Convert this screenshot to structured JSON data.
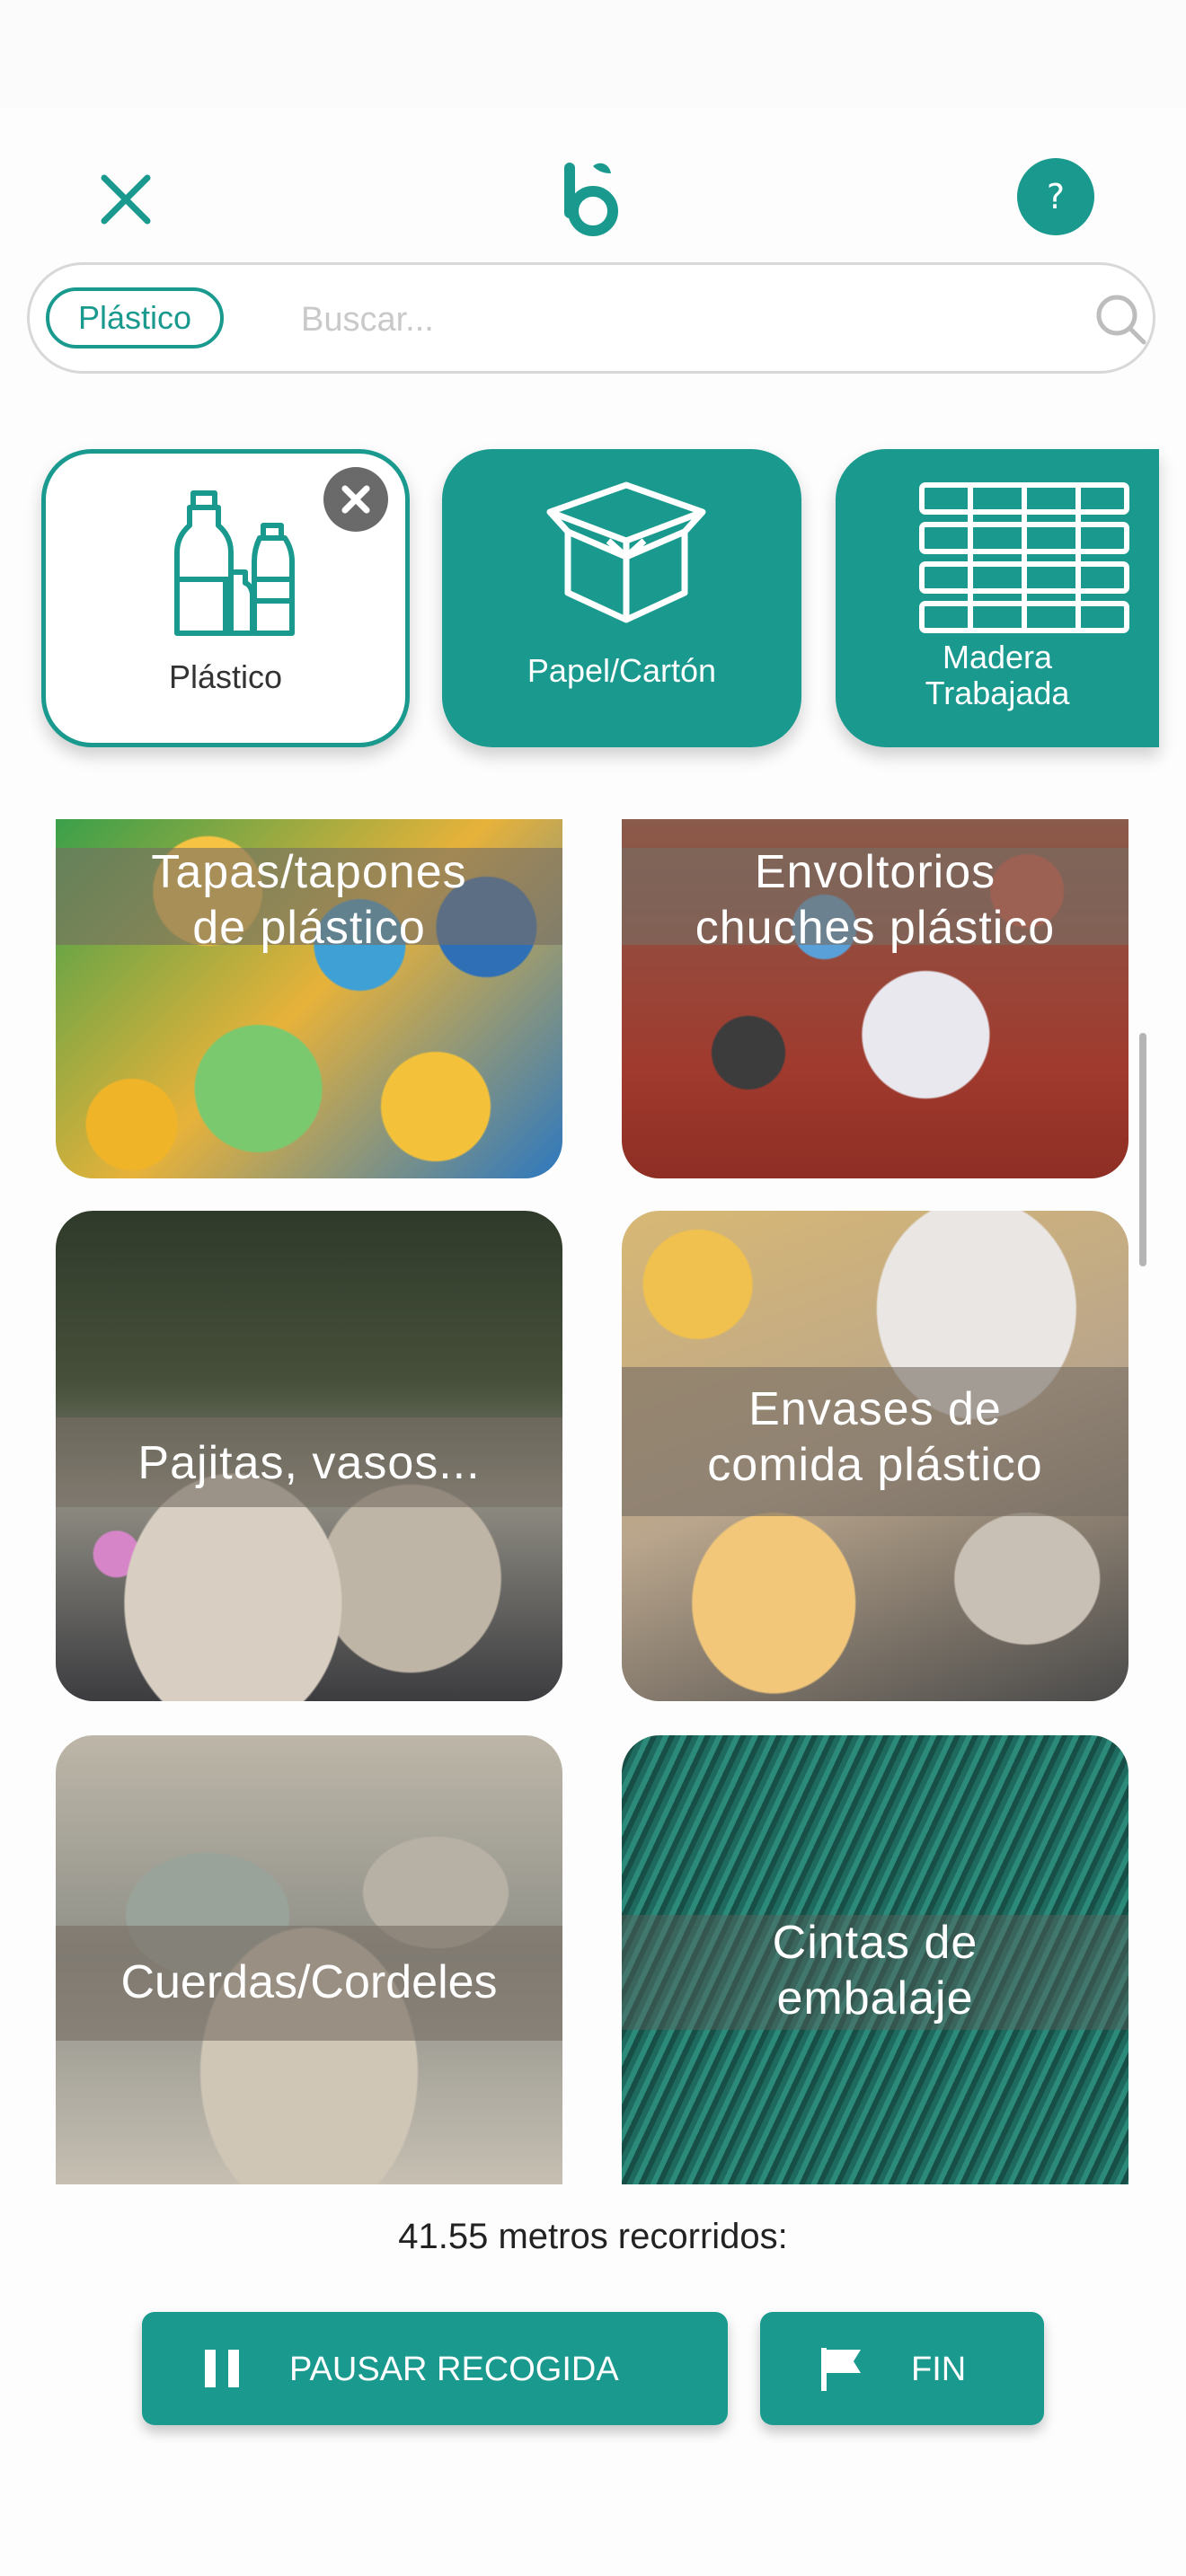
{
  "header": {
    "close_icon": "close-icon",
    "logo_icon": "app-logo-icon",
    "help_label": "?"
  },
  "search": {
    "chip_label": "Plástico",
    "placeholder": "Buscar...",
    "value": ""
  },
  "categories": [
    {
      "label": "Plástico",
      "icon": "bottles-icon",
      "selected": true
    },
    {
      "label": "Papel/Cartón",
      "icon": "box-icon",
      "selected": false
    },
    {
      "label_line1": "Madera",
      "label_line2": "Trabajada",
      "icon": "pallet-icon",
      "selected": false
    }
  ],
  "items": [
    {
      "line1": "Tapas/tapones",
      "line2": "de plástico"
    },
    {
      "line1": "Envoltorios",
      "line2": "chuches plástico"
    },
    {
      "line1": "Pajitas, vasos...",
      "line2": ""
    },
    {
      "line1": "Envases de",
      "line2": "comida plástico"
    },
    {
      "line1": "Cuerdas/Cordeles",
      "line2": ""
    },
    {
      "line1": "Cintas de",
      "line2": "embalaje"
    }
  ],
  "status": {
    "distance_text": "41.55 metros recorridos:"
  },
  "actions": {
    "pause_label": "PAUSAR RECOGIDA",
    "end_label": "FIN"
  },
  "colors": {
    "accent": "#1a9a8e",
    "badge_gray": "#6a6a6a"
  }
}
